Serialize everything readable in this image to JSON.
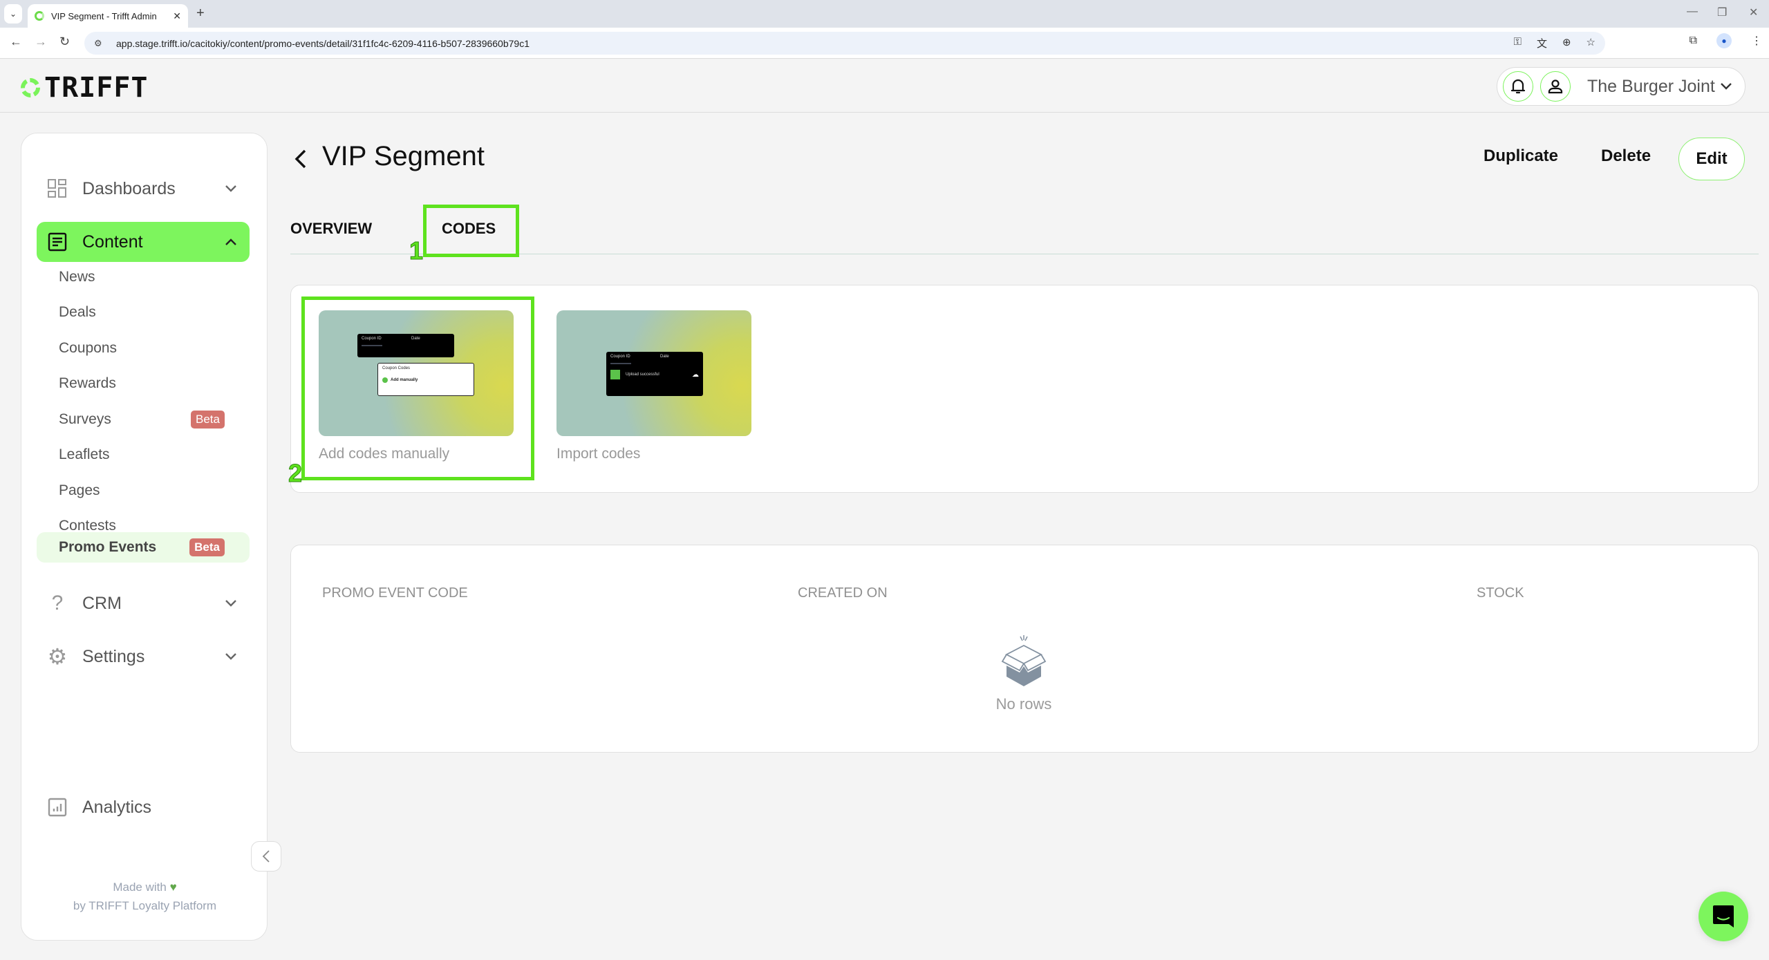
{
  "browser": {
    "tab_title": "VIP Segment - Trifft Admin",
    "url": "app.stage.trifft.io/cacitokiy/content/promo-events/detail/31f1fc4c-6209-4116-b507-2839660b79c1"
  },
  "header": {
    "logo_text": "TRIFFT",
    "account_name": "The Burger Joint"
  },
  "sidebar": {
    "sections": [
      {
        "label": "Dashboards",
        "icon": "dashboard-grid-icon"
      },
      {
        "label": "Content",
        "icon": "document-lines-icon",
        "active": true
      },
      {
        "label": "CRM",
        "icon": "question-icon"
      },
      {
        "label": "Settings",
        "icon": "gear-icon"
      }
    ],
    "content_items": [
      {
        "label": "News"
      },
      {
        "label": "Deals"
      },
      {
        "label": "Coupons"
      },
      {
        "label": "Rewards"
      },
      {
        "label": "Surveys",
        "badge": "Beta"
      },
      {
        "label": "Leaflets"
      },
      {
        "label": "Pages"
      },
      {
        "label": "Contests"
      },
      {
        "label": "Promo Events",
        "badge": "Beta",
        "selected": true
      }
    ],
    "analytics_label": "Analytics",
    "footer_line1": "Made with",
    "footer_heart": "♥",
    "footer_line2": "by TRIFFT Loyalty Platform"
  },
  "page": {
    "title": "VIP Segment",
    "actions": {
      "duplicate": "Duplicate",
      "delete": "Delete",
      "edit": "Edit"
    },
    "tabs": [
      {
        "label": "OVERVIEW"
      },
      {
        "label": "CODES",
        "active": true
      }
    ],
    "annotations": {
      "tab_marker": "1",
      "card_marker": "2"
    },
    "options": [
      {
        "label": "Add codes manually",
        "preview": {
          "col1": "Coupon ID",
          "col2": "Date",
          "popup_title": "Coupon Codes",
          "popup_action": "Add manually"
        }
      },
      {
        "label": "Import codes",
        "preview": {
          "col1": "Coupon ID",
          "col2": "Date",
          "status": "Upload successful"
        }
      }
    ],
    "table": {
      "columns": [
        "PROMO EVENT CODE",
        "CREATED ON",
        "STOCK"
      ],
      "rows": [],
      "empty_text": "No rows"
    }
  },
  "colors": {
    "accent_green": "#7df55d",
    "badge_red": "#d4736c",
    "annotation_green": "#5ee21e"
  }
}
